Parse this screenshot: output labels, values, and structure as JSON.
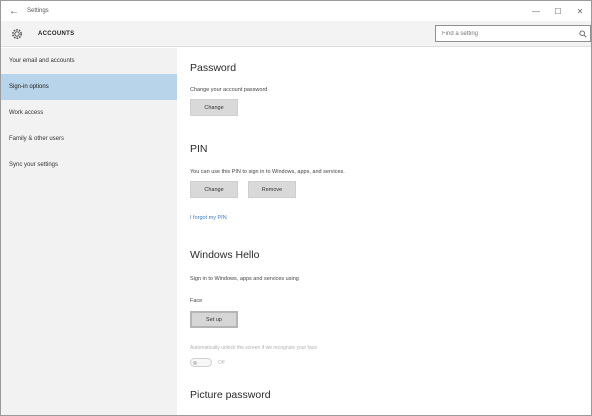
{
  "window": {
    "title": "Settings",
    "controls": {
      "minimize": "—",
      "maximize": "☐",
      "close": "✕"
    }
  },
  "header": {
    "app_name": "ACCOUNTS",
    "search_placeholder": "Find a setting"
  },
  "sidebar": {
    "items": [
      {
        "label": "Your email and accounts"
      },
      {
        "label": "Sign-in options"
      },
      {
        "label": "Work access"
      },
      {
        "label": "Family & other users"
      },
      {
        "label": "Sync your settings"
      }
    ],
    "selected_index": 1
  },
  "password": {
    "title": "Password",
    "desc": "Change your account password",
    "change_label": "Change"
  },
  "pin": {
    "title": "PIN",
    "desc": "You can use this PIN to sign in to Windows, apps, and services.",
    "change_label": "Change",
    "remove_label": "Remove",
    "forgot_link": "I forgot my PIN"
  },
  "hello": {
    "title": "Windows Hello",
    "desc": "Sign in to Windows, apps and services using",
    "face_label": "Face",
    "setup_label": "Set up",
    "auto_unlock_desc": "Automatically unlock the screen if we recognize your face",
    "toggle_label": "Off",
    "toggle_state": "off"
  },
  "picture_password": {
    "title": "Picture password"
  },
  "colors": {
    "selected_nav": "#b8d4ea",
    "link": "#3a7fc4",
    "button": "#d9d9d9",
    "sidebar_bg": "#f2f2f2"
  },
  "icons": {
    "back": "back-arrow-icon",
    "settings": "gear-icon",
    "search": "search-icon"
  }
}
